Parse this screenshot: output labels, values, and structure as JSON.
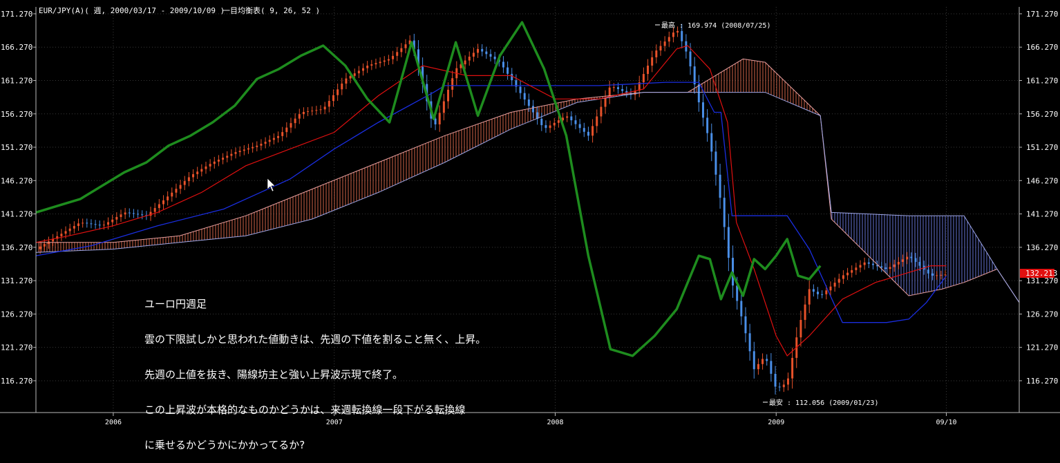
{
  "header": {
    "symbol": "EUR/JPY(A)( 週, 2000/03/17 - 2009/10/09 )",
    "indicator": "一目均衡表( 9, 26, 52 )"
  },
  "comment": {
    "lines": [
      "ユーロ円週足",
      "雲の下限試しかと思われた値動きは、先週の下値を割ること無く、上昇。",
      "先週の上値を抜き、陽線坊主と強い上昇波示現で終了。",
      "この上昇波が本格的なものかどうかは、来週転換線一段下がる転換線",
      "に乗せるかどうかにかかってるか?"
    ]
  },
  "annotations": {
    "high": "最高 : 169.974 (2008/07/25)",
    "low": "最安 : 112.056 (2009/01/23)"
  },
  "colors": {
    "background": "#000000",
    "grid": "#3a3a3a",
    "up_candle": "#e8522a",
    "down_candle": "#4a8fe8",
    "tenkan": "#e01010",
    "kijun": "#1a2ee0",
    "chikou": "#1e8c1e",
    "cloud_bear": "#e87050",
    "cloud_bull": "#6f7fe8",
    "price_tag": "#e01010"
  },
  "chart_data": {
    "type": "line",
    "ylim": [
      111.5,
      172.3
    ],
    "y_ticks": [
      "171.270",
      "166.270",
      "161.270",
      "156.270",
      "151.270",
      "146.270",
      "141.270",
      "136.270",
      "131.270",
      "126.270",
      "121.270",
      "116.270"
    ],
    "y_tick_values": [
      171.27,
      166.27,
      161.27,
      156.27,
      151.27,
      146.27,
      141.27,
      136.27,
      131.27,
      126.27,
      121.27,
      116.27
    ],
    "x_range": [
      2005.65,
      2010.1
    ],
    "x_ticks": [
      {
        "label": "2006",
        "t": 2006.0
      },
      {
        "label": "2007",
        "t": 2007.0
      },
      {
        "label": "2008",
        "t": 2008.0
      },
      {
        "label": "2009",
        "t": 2009.0
      },
      {
        "label": "09/10",
        "t": 2009.77
      }
    ],
    "last_price": "132.213",
    "series": [
      {
        "key": "price",
        "x": [
          2005.65,
          2005.75,
          2005.85,
          2005.95,
          2006.05,
          2006.15,
          2006.25,
          2006.35,
          2006.45,
          2006.55,
          2006.65,
          2006.75,
          2006.85,
          2006.95,
          2007.05,
          2007.15,
          2007.25,
          2007.35,
          2007.45,
          2007.55,
          2007.65,
          2007.75,
          2007.85,
          2007.95,
          2008.05,
          2008.15,
          2008.25,
          2008.35,
          2008.45,
          2008.55,
          2008.6,
          2008.65,
          2008.7,
          2008.75,
          2008.8,
          2008.85,
          2008.9,
          2008.95,
          2009.0,
          2009.05,
          2009.1,
          2009.15,
          2009.2,
          2009.3,
          2009.4,
          2009.5,
          2009.6,
          2009.7,
          2009.77
        ],
        "values": [
          136.0,
          138.0,
          140.0,
          139.5,
          141.5,
          141.0,
          144.0,
          147.0,
          149.0,
          150.5,
          151.5,
          153.0,
          156.5,
          157.0,
          161.5,
          163.5,
          164.5,
          167.5,
          154.0,
          163.0,
          166.0,
          164.0,
          159.0,
          154.0,
          156.0,
          153.0,
          160.5,
          159.0,
          165.5,
          169.0,
          165.0,
          158.0,
          152.0,
          143.0,
          131.0,
          125.0,
          118.0,
          120.0,
          115.0,
          116.0,
          124.0,
          130.0,
          129.0,
          132.0,
          134.0,
          133.0,
          135.0,
          132.0,
          132.2
        ]
      },
      {
        "key": "tenkan",
        "x": [
          2005.65,
          2005.8,
          2006.0,
          2006.2,
          2006.4,
          2006.6,
          2006.8,
          2007.0,
          2007.2,
          2007.4,
          2007.6,
          2007.8,
          2008.0,
          2008.2,
          2008.4,
          2008.55,
          2008.6,
          2008.7,
          2008.78,
          2008.82,
          2008.9,
          2009.0,
          2009.05,
          2009.15,
          2009.3,
          2009.45,
          2009.6,
          2009.7,
          2009.77
        ],
        "values": [
          137.0,
          138.0,
          139.5,
          141.5,
          144.5,
          148.5,
          151.0,
          153.5,
          159.0,
          163.5,
          162.0,
          162.0,
          158.5,
          158.5,
          160.0,
          166.0,
          166.5,
          163.0,
          155.0,
          140.0,
          133.0,
          123.0,
          120.0,
          123.0,
          128.5,
          131.0,
          132.5,
          133.5,
          133.5
        ]
      },
      {
        "key": "kijun",
        "x": [
          2005.65,
          2005.9,
          2006.2,
          2006.5,
          2006.8,
          2007.0,
          2007.2,
          2007.45,
          2007.5,
          2007.9,
          2008.2,
          2008.5,
          2008.65,
          2008.72,
          2008.75,
          2008.8,
          2009.05,
          2009.15,
          2009.3,
          2009.5,
          2009.6,
          2009.68,
          2009.77
        ],
        "values": [
          135.0,
          136.5,
          139.5,
          142.0,
          146.5,
          151.0,
          155.0,
          159.5,
          160.5,
          160.5,
          160.5,
          161.0,
          161.0,
          156.5,
          156.5,
          141.0,
          141.0,
          136.0,
          125.0,
          125.0,
          125.5,
          128.0,
          132.0
        ]
      },
      {
        "key": "chikou",
        "x": [
          2005.65,
          2005.75,
          2005.85,
          2005.95,
          2006.05,
          2006.15,
          2006.25,
          2006.35,
          2006.45,
          2006.55,
          2006.65,
          2006.75,
          2006.85,
          2006.95,
          2007.05,
          2007.15,
          2007.25,
          2007.35,
          2007.45,
          2007.55,
          2007.65,
          2007.75,
          2007.85,
          2007.95,
          2008.05,
          2008.15,
          2008.25,
          2008.35,
          2008.45,
          2008.55,
          2008.6,
          2008.65,
          2008.7,
          2008.75,
          2008.8,
          2008.85,
          2008.9,
          2008.95,
          2009.0,
          2009.05,
          2009.1,
          2009.15,
          2009.2
        ],
        "values": [
          141.5,
          142.5,
          143.5,
          145.5,
          147.5,
          149.0,
          151.5,
          153.0,
          155.0,
          157.5,
          161.5,
          163.0,
          165.0,
          166.5,
          163.5,
          158.5,
          155.0,
          167.0,
          155.5,
          167.0,
          156.0,
          165.0,
          170.0,
          163.0,
          153.0,
          135.0,
          121.0,
          120.0,
          123.0,
          127.0,
          131.0,
          135.0,
          134.5,
          128.5,
          132.5,
          129.0,
          134.5,
          133.0,
          135.0,
          137.5,
          132.0,
          131.5,
          133.5
        ]
      },
      {
        "key": "senkou_a",
        "x": [
          2005.65,
          2006.0,
          2006.3,
          2006.6,
          2006.9,
          2007.2,
          2007.5,
          2007.8,
          2008.1,
          2008.4,
          2008.6,
          2008.7,
          2008.85,
          2008.95,
          2009.2,
          2009.25,
          2009.6,
          2009.75,
          2009.85,
          2010.0,
          2010.1
        ],
        "values": [
          137.0,
          137.0,
          138.0,
          141.0,
          145.0,
          149.0,
          153.0,
          156.5,
          158.5,
          159.5,
          159.5,
          161.5,
          164.5,
          164.0,
          156.0,
          140.5,
          129.0,
          130.0,
          131.0,
          133.0,
          128.0
        ]
      },
      {
        "key": "senkou_b",
        "x": [
          2005.65,
          2006.0,
          2006.3,
          2006.6,
          2006.9,
          2007.2,
          2007.5,
          2007.8,
          2008.1,
          2008.4,
          2008.6,
          2008.7,
          2008.85,
          2008.95,
          2009.2,
          2009.25,
          2009.6,
          2009.75,
          2009.85,
          2010.0,
          2010.1
        ],
        "values": [
          135.5,
          136.0,
          137.0,
          138.0,
          140.5,
          144.5,
          149.0,
          154.0,
          158.0,
          159.5,
          159.5,
          159.5,
          159.5,
          159.5,
          156.0,
          141.5,
          141.0,
          141.0,
          141.0,
          133.0,
          128.0
        ]
      }
    ]
  }
}
